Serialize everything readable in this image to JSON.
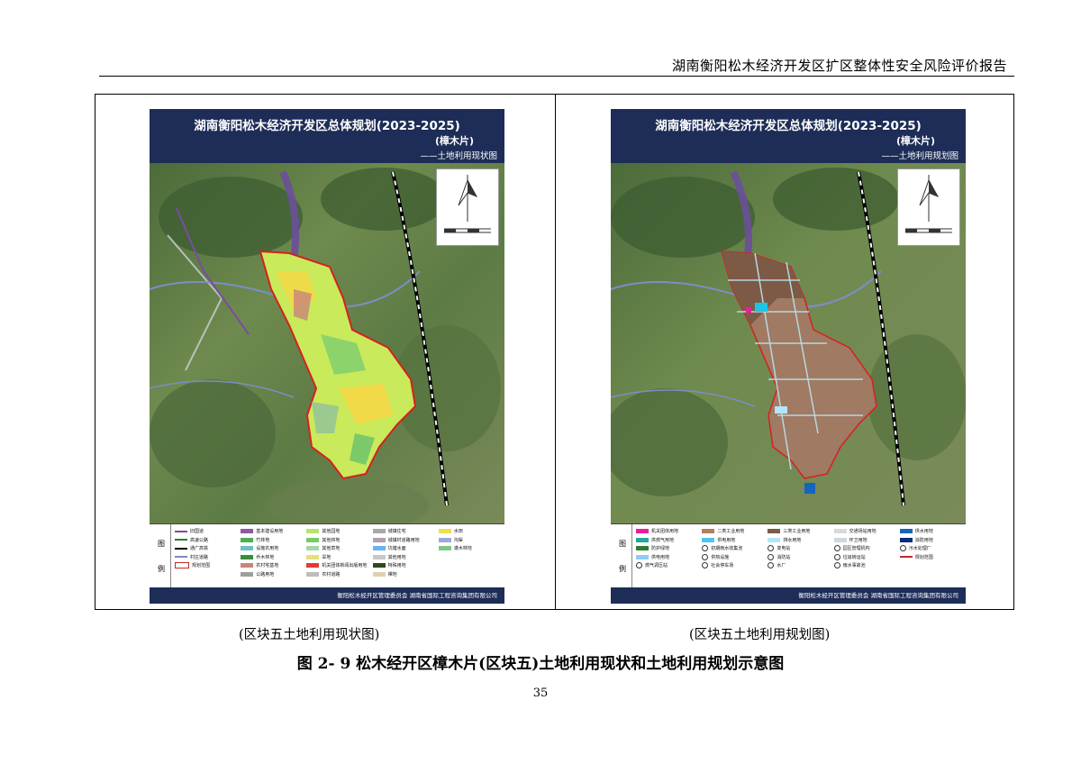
{
  "header": {
    "title": "湖南衡阳松木经济开发区扩区整体性安全风险评价报告"
  },
  "maps": {
    "left": {
      "title": "湖南衡阳松木经济开发区总体规划(2023-2025)",
      "area": "(樟木片)",
      "subtitle": "——土地利用现状图",
      "legend_label": [
        "图",
        "例"
      ],
      "credit": "衡阳松木经开区管理委员会  湖南省国际工程咨询集团有限公司",
      "legend": [
        {
          "label": "旧国道",
          "kind": "line",
          "color": "#7a4da0"
        },
        {
          "label": "基本建设用地",
          "kind": "swatch",
          "color": "#8e5aa0"
        },
        {
          "label": "其他园地",
          "kind": "swatch",
          "color": "#b5e36b"
        },
        {
          "label": "城镇住宅",
          "kind": "swatch",
          "color": "#a8a8a8"
        },
        {
          "label": "水田",
          "kind": "swatch",
          "color": "#f2dc4f"
        },
        {
          "label": "高速公路",
          "kind": "line",
          "color": "#2e7d32"
        },
        {
          "label": "竹林地",
          "kind": "swatch",
          "color": "#4caf50"
        },
        {
          "label": "其他林地",
          "kind": "swatch",
          "color": "#7cc96a"
        },
        {
          "label": "城镇村道路用地",
          "kind": "swatch",
          "color": "#b0a0b0"
        },
        {
          "label": "沟渠",
          "kind": "swatch",
          "color": "#9fa8da"
        },
        {
          "label": "通广高铁",
          "kind": "line",
          "color": "#000000"
        },
        {
          "label": "设施农用地",
          "kind": "swatch",
          "color": "#6fbfc8"
        },
        {
          "label": "其他草地",
          "kind": "swatch",
          "color": "#a5d6a7"
        },
        {
          "label": "坑塘水面",
          "kind": "swatch",
          "color": "#64b5f6"
        },
        {
          "label": "灌木林地",
          "kind": "swatch",
          "color": "#81c784"
        },
        {
          "label": "村庄道路",
          "kind": "line",
          "color": "#7a8cc0"
        },
        {
          "label": "乔木林地",
          "kind": "swatch",
          "color": "#388e3c"
        },
        {
          "label": "旱地",
          "kind": "swatch",
          "color": "#e6e07a"
        },
        {
          "label": "其他用地",
          "kind": "swatch",
          "color": "#c8c8c8"
        },
        {
          "label": "",
          "kind": "none",
          "color": "#ffffff"
        },
        {
          "label": "规划范围",
          "kind": "swatch",
          "color": "#ffffff"
        },
        {
          "label": "农村宅基地",
          "kind": "swatch",
          "color": "#c9857a"
        },
        {
          "label": "机关团体新闻出版用地",
          "kind": "swatch",
          "color": "#e53935"
        },
        {
          "label": "特殊用地",
          "kind": "swatch",
          "color": "#2e4a1e"
        },
        {
          "label": "",
          "kind": "none",
          "color": "#ffffff"
        },
        {
          "label": "",
          "kind": "none",
          "color": "#ffffff"
        },
        {
          "label": "公路用地",
          "kind": "swatch",
          "color": "#9e9e9e"
        },
        {
          "label": "农村道路",
          "kind": "swatch",
          "color": "#bdbdbd"
        },
        {
          "label": "裸地",
          "kind": "swatch",
          "color": "#e0d0b0"
        },
        {
          "label": "",
          "kind": "none",
          "color": "#ffffff"
        }
      ]
    },
    "right": {
      "title": "湖南衡阳松木经济开发区总体规划(2023-2025)",
      "area": "(樟木片)",
      "subtitle": "——土地利用规划图",
      "legend_label": [
        "图",
        "例"
      ],
      "credit": "衡阳松木经开区管理委员会  湖南省国际工程咨询集团有限公司",
      "legend": [
        {
          "label": "机关团体用地",
          "kind": "swatch",
          "color": "#e91e9c"
        },
        {
          "label": "二类工业用地",
          "kind": "swatch",
          "color": "#b08060"
        },
        {
          "label": "三类工业用地",
          "kind": "swatch",
          "color": "#7d5a46"
        },
        {
          "label": "交通场站用地",
          "kind": "swatch",
          "color": "#d9d9d9"
        },
        {
          "label": "供水用地",
          "kind": "swatch",
          "color": "#1565c0"
        },
        {
          "label": "供燃气用地",
          "kind": "swatch",
          "color": "#26a69a"
        },
        {
          "label": "供电用地",
          "kind": "swatch",
          "color": "#4fc3f7"
        },
        {
          "label": "排水用地",
          "kind": "swatch",
          "color": "#b3e5fc"
        },
        {
          "label": "环卫用地",
          "kind": "swatch",
          "color": "#cfd8dc"
        },
        {
          "label": "消防用地",
          "kind": "swatch",
          "color": "#0d2a7a"
        },
        {
          "label": "防护绿地",
          "kind": "swatch",
          "color": "#2e7d32"
        },
        {
          "label": "初期雨水收集池",
          "kind": "symbol",
          "color": "#ffffff"
        },
        {
          "label": "变电站",
          "kind": "symbol",
          "color": "#ffffff"
        },
        {
          "label": "园区管理机构",
          "kind": "symbol",
          "color": "#ffffff"
        },
        {
          "label": "污水处理厂",
          "kind": "symbol",
          "color": "#ffffff"
        },
        {
          "label": "供电用地",
          "kind": "swatch",
          "color": "#90caf9"
        },
        {
          "label": "供热设施",
          "kind": "symbol",
          "color": "#ffffff"
        },
        {
          "label": "消防站",
          "kind": "symbol",
          "color": "#ffffff"
        },
        {
          "label": "垃圾转运站",
          "kind": "symbol",
          "color": "#ffffff"
        },
        {
          "label": "规划范围",
          "kind": "line",
          "color": "#c62828"
        },
        {
          "label": "燃气调压站",
          "kind": "symbol",
          "color": "#ffffff"
        },
        {
          "label": "社会停车场",
          "kind": "symbol",
          "color": "#ffffff"
        },
        {
          "label": "水厂",
          "kind": "symbol",
          "color": "#ffffff"
        },
        {
          "label": "雨水事故池",
          "kind": "symbol",
          "color": "#ffffff"
        },
        {
          "label": "",
          "kind": "none",
          "color": "#ffffff"
        }
      ]
    }
  },
  "captions": {
    "left": "(区块五土地利用现状图)",
    "right": "(区块五土地利用规划图)"
  },
  "figure_title": "图 2- 9 松木经开区樟木片(区块五)土地利用现状和土地利用规划示意图",
  "page_number": "35"
}
